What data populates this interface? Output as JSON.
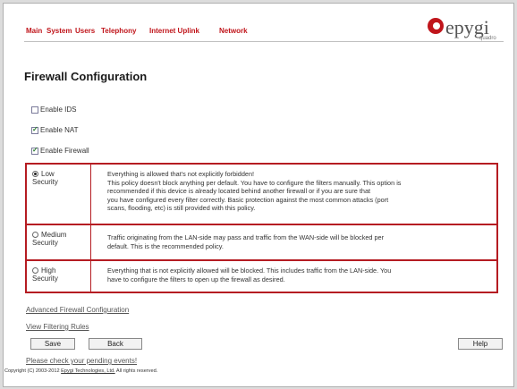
{
  "nav": {
    "items": [
      "Main",
      "System",
      "Users",
      "Telephony",
      "Internet Uplink",
      "Network"
    ]
  },
  "logo": {
    "word": "epygi",
    "sub": "quadro"
  },
  "page_title": "Firewall Configuration",
  "checkboxes": [
    {
      "label": "Enable IDS",
      "checked": false
    },
    {
      "label": "Enable NAT",
      "checked": true
    },
    {
      "label": "Enable Firewall",
      "checked": true
    }
  ],
  "policies": [
    {
      "label_line1": "Low",
      "label_line2": "Security",
      "selected": true,
      "desc_lines": [
        "Everything is allowed that's not explicitly forbidden!",
        "This policy doesn't block anything per default. You have to configure the filters manually. This option is",
        "recommended if this device is already located behind another firewall or if you are sure that",
        "you have configured every filter correctly. Basic protection against the most common attacks (port",
        "scans, flooding, etc) is still provided with this policy."
      ]
    },
    {
      "label_line1": "Medium",
      "label_line2": "Security",
      "selected": false,
      "desc_lines": [
        "Traffic originating from the LAN-side may pass and traffic from the WAN-side will be blocked per",
        "default. This is the recommended policy."
      ]
    },
    {
      "label_line1": "High",
      "label_line2": "Security",
      "selected": false,
      "desc_lines": [
        "Everything that is not explicitly allowed will be blocked. This includes traffic from the LAN-side. You",
        "have to configure the filters to open up the firewall as desired."
      ]
    }
  ],
  "links": {
    "advanced": "Advanced Firewall Configuration",
    "filtering": "View Filtering Rules"
  },
  "buttons": {
    "save": "Save",
    "back": "Back",
    "help": "Help"
  },
  "pending": "Please check your pending events!",
  "copyright": {
    "prefix": "Copyright (C) 2003-2012 ",
    "company": "Epygi Technologies, Ltd.",
    "suffix": " All rights reserved."
  },
  "colors": {
    "accent": "#c0151b",
    "border": "#b51c22"
  }
}
